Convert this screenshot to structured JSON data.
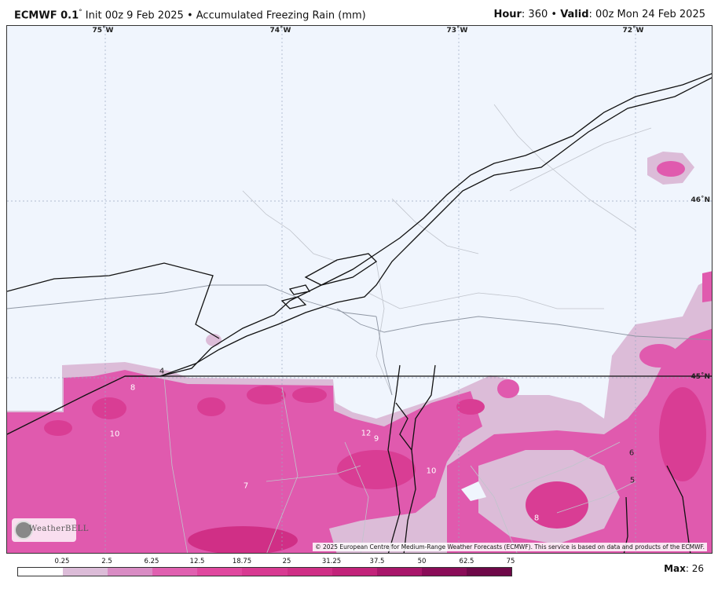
{
  "header": {
    "model": "ECMWF 0.1",
    "degree": "°",
    "init_text": " Init 00z 9 Feb 2025 • Accumulated Freezing Rain (mm)",
    "hour_label": "Hour",
    "hour_value": ": 360 • ",
    "valid_label": "Valid",
    "valid_value": ": 00z Mon 24 Feb 2025"
  },
  "map": {
    "lon_labels": [
      "75˚W",
      "74˚W",
      "73˚W",
      "72˚W"
    ],
    "lat_labels": [
      "46˚N",
      "45˚N"
    ],
    "copyright": "© 2025 European Centre for Medium-Range Weather Forecasts (ECMWF). This service is based on data and products of the ECMWF.",
    "logo_text": "WeatherBELL",
    "values": [
      "4",
      "8",
      "10",
      "7",
      "12",
      "9",
      "10",
      "8",
      "6",
      "5"
    ]
  },
  "legend": {
    "labels": [
      "0.25",
      "2.5",
      "6.25",
      "12.5",
      "18.75",
      "25",
      "31.25",
      "37.5",
      "50",
      "62.5",
      "75"
    ],
    "colors": [
      "#ffffff",
      "#dcbcd8",
      "#d98cc4",
      "#e060b0",
      "#e0489f",
      "#d83a92",
      "#cf2f86",
      "#c2237a",
      "#a8166a",
      "#8a0c58",
      "#6e0848"
    ]
  },
  "max": {
    "label": "Max",
    "value": ": 26"
  }
}
